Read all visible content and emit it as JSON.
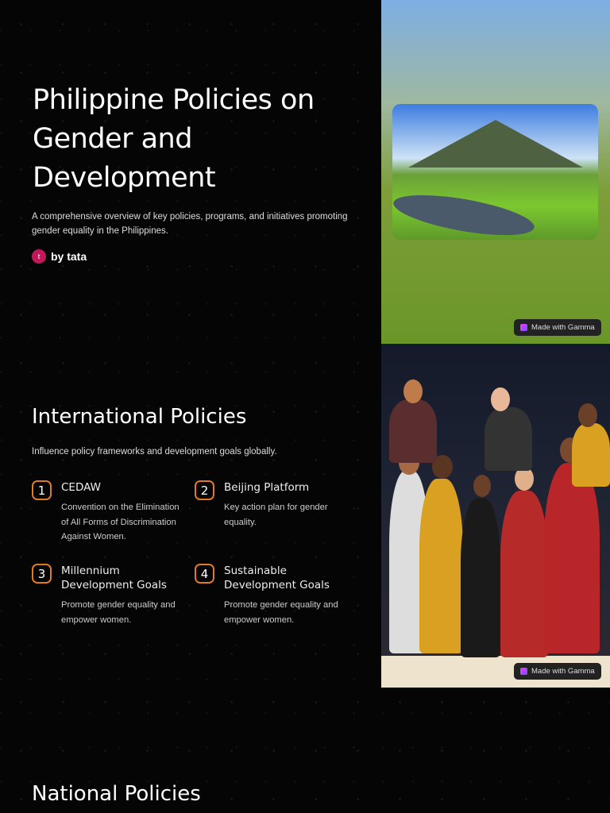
{
  "hero": {
    "title": "Philippine Policies on Gender and Development",
    "subtitle": "A comprehensive overview of key policies, programs, and initiatives promoting gender equality in the Philippines.",
    "author_initial": "t",
    "author": "by tata"
  },
  "badge": {
    "label": "Made with Gamma"
  },
  "international": {
    "title": "International Policies",
    "intro": "Influence policy frameworks and development goals globally.",
    "items": [
      {
        "num": "1",
        "title": "CEDAW",
        "desc": "Convention on the Elimination of All Forms of Discrimination Against Women."
      },
      {
        "num": "2",
        "title": "Beijing Platform",
        "desc": "Key action plan for gender equality."
      },
      {
        "num": "3",
        "title": "Millennium Development Goals",
        "desc": "Promote gender equality and empower women."
      },
      {
        "num": "4",
        "title": "Sustainable Development Goals",
        "desc": "Promote gender equality and empower women."
      }
    ]
  },
  "national": {
    "title": "National Policies"
  },
  "colors": {
    "accent": "#e07a24",
    "avatar": "#c2185b"
  }
}
